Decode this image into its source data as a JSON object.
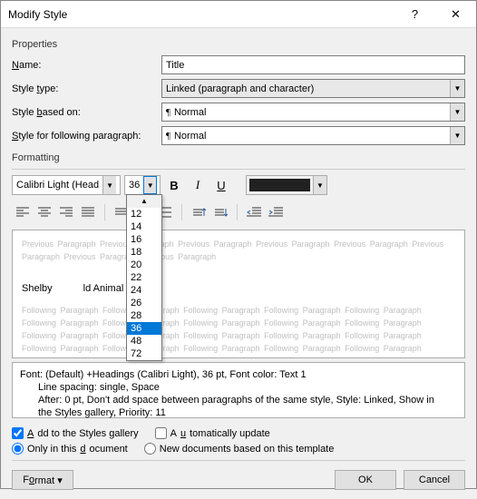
{
  "window": {
    "title": "Modify Style",
    "help": "?",
    "close": "✕"
  },
  "properties": {
    "section": "Properties",
    "name_label": "Name:",
    "name_u": "N",
    "name_value": "Title",
    "type_label": "Style type:",
    "type_u": "t",
    "type_value": "Linked (paragraph and character)",
    "based_label": "Style based on:",
    "based_u": "b",
    "based_value": "Normal",
    "following_label": "Style for following paragraph:",
    "following_u": "S",
    "following_value": "Normal",
    "para_icon": "¶"
  },
  "formatting": {
    "section": "Formatting",
    "font": "Calibri Light (Head",
    "size": "36",
    "sizes": [
      "12",
      "14",
      "16",
      "18",
      "20",
      "22",
      "24",
      "26",
      "28",
      "36",
      "48",
      "72"
    ],
    "bold": "B",
    "italic": "I",
    "underline": "U",
    "color": "#212121"
  },
  "preview": {
    "prev_text": "Previous Paragraph Previous Paragraph Previous Paragraph Previous Paragraph Previous Paragraph Previous",
    "prev_text2": "Paragraph Previous Paragraph Previous Paragraph",
    "sample_a": "Shelby",
    "sample_b": "ld Animal Rescue",
    "follow_text": "Following Paragraph Following Paragraph Following Paragraph Following Paragraph Following Paragraph"
  },
  "description": {
    "line1": "Font: (Default) +Headings (Calibri Light), 36 pt, Font color: Text 1",
    "line2": "Line spacing:  single, Space",
    "line3": "After:  0 pt, Don't add space between paragraphs of the same style, Style: Linked, Show in",
    "line4": "the Styles gallery, Priority: 11"
  },
  "options": {
    "add_gallery": "Add to the Styles gallery",
    "add_u": "A",
    "auto_update": "Automatically update",
    "auto_u": "u",
    "only_doc": "Only in this document",
    "only_u": "d",
    "new_docs": "New documents based on this template"
  },
  "buttons": {
    "format": "Format",
    "format_u": "o",
    "ok": "OK",
    "cancel": "Cancel"
  }
}
